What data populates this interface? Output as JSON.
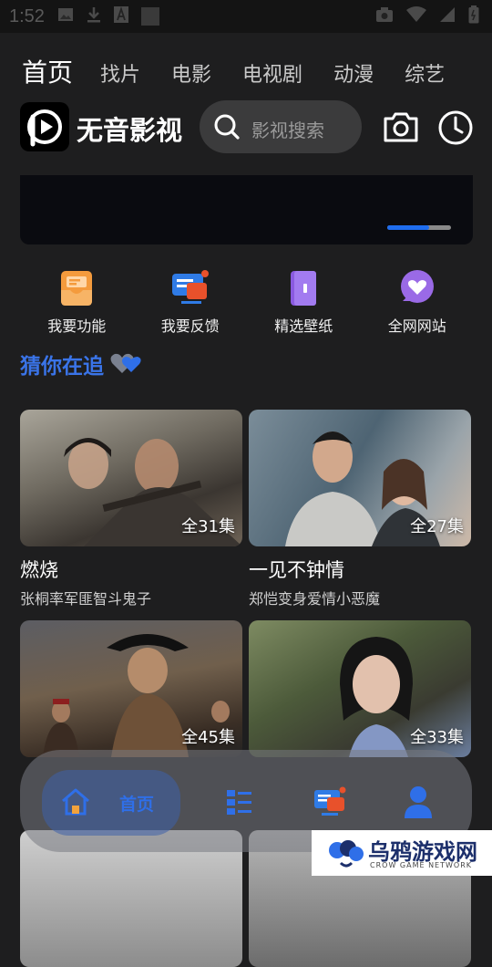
{
  "status_bar": {
    "time": "1:52"
  },
  "tabs": [
    {
      "label": "首页",
      "active": true
    },
    {
      "label": "找片"
    },
    {
      "label": "电影"
    },
    {
      "label": "电视剧"
    },
    {
      "label": "动漫"
    },
    {
      "label": "综艺"
    }
  ],
  "brand": {
    "name": "无音影视"
  },
  "search": {
    "placeholder": "影视搜索"
  },
  "banner": {
    "active_index": 0,
    "count": 2
  },
  "quick_actions": [
    {
      "label": "我要功能",
      "icon": "inbox-icon",
      "color": "#f49b3d"
    },
    {
      "label": "我要反馈",
      "icon": "feedback-icon",
      "color": "#2f7be6"
    },
    {
      "label": "精选壁纸",
      "icon": "wallpaper-icon",
      "color": "#9a6ae6"
    },
    {
      "label": "全网网站",
      "icon": "heart-chat-icon",
      "color": "#9a6ae6"
    }
  ],
  "section": {
    "title": "猜你在追"
  },
  "cards": [
    {
      "title": "燃烧",
      "subtitle": "张桐率军匪智斗鬼子",
      "episodes": "全31集"
    },
    {
      "title": "一见不钟情",
      "subtitle": "郑恺变身爱情小恶魔",
      "episodes": "全27集"
    },
    {
      "title": "",
      "subtitle": "",
      "episodes": "全45集"
    },
    {
      "title": "",
      "subtitle": "",
      "episodes": "全33集"
    }
  ],
  "bottom_nav": [
    {
      "label": "首页",
      "icon": "home-icon",
      "active": true
    },
    {
      "label": "",
      "icon": "list-icon"
    },
    {
      "label": "",
      "icon": "feedback-icon"
    },
    {
      "label": "",
      "icon": "user-icon"
    }
  ],
  "watermark": {
    "title": "乌鸦游戏网",
    "subtitle": "CROW GAME NETWORK"
  },
  "colors": {
    "accent": "#2f6fe8",
    "background": "#1e1e1f"
  }
}
